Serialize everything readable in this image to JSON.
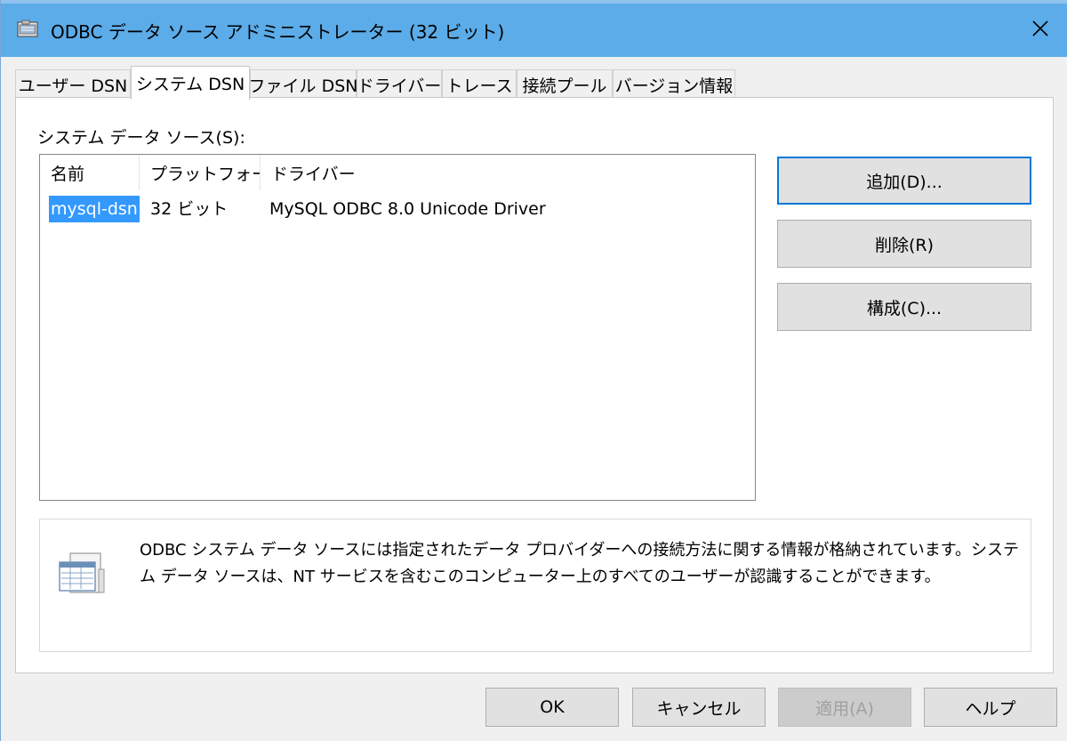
{
  "window": {
    "title": "ODBC データ ソース アドミニストレーター (32 ビット)"
  },
  "tabs": [
    {
      "label": "ユーザー DSN",
      "active": false
    },
    {
      "label": "システム DSN",
      "active": true
    },
    {
      "label": "ファイル DSN",
      "active": false
    },
    {
      "label": "ドライバー",
      "active": false
    },
    {
      "label": "トレース",
      "active": false
    },
    {
      "label": "接続プール",
      "active": false
    },
    {
      "label": "バージョン情報",
      "active": false
    }
  ],
  "panel": {
    "group_label": "システム データ ソース(S):",
    "columns": [
      "名前",
      "プラットフォーム",
      "ドライバー"
    ],
    "rows": [
      {
        "name": "mysql-dsn",
        "platform": "32 ビット",
        "driver": "MySQL ODBC 8.0 Unicode Driver",
        "selected": true
      }
    ],
    "buttons": {
      "add": "追加(D)...",
      "remove": "削除(R)",
      "configure": "構成(C)..."
    },
    "info_text": "ODBC システム データ ソースには指定されたデータ プロバイダーへの接続方法に関する情報が格納されています。システム データ ソースは、NT サービスを含むこのコンピューター上のすべてのユーザーが認識することができます。",
    "info_icon": "data-source-icon"
  },
  "footer": {
    "ok": "OK",
    "cancel": "キャンセル",
    "apply": "適用(A)",
    "help": "ヘルプ"
  },
  "colors": {
    "titlebar": "#5bace8",
    "selection": "#3399ff",
    "default_button_border": "#0078d7"
  }
}
